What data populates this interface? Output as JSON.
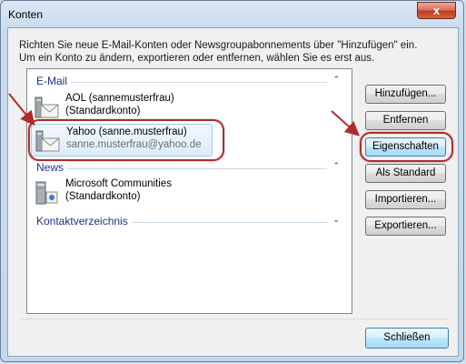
{
  "window": {
    "title": "Konten",
    "close_glyph": "x"
  },
  "info": {
    "line1": "Richten Sie neue E-Mail-Konten oder Newsgroupabonnements über \"Hinzufügen\" ein.",
    "line2": "Um ein Konto zu ändern, exportieren oder entfernen, wählen Sie es erst aus."
  },
  "groups": {
    "email": {
      "title": "E-Mail",
      "chevron": "⌃",
      "items": [
        {
          "line1": "AOL (sannemusterfrau)",
          "line2": "(Standardkonto)",
          "icon": "mail-account-icon"
        },
        {
          "line1": "Yahoo (sanne.musterfrau)",
          "line2": "sanne.musterfrau@yahoo.de",
          "icon": "mail-account-icon",
          "selected": true
        }
      ]
    },
    "news": {
      "title": "News",
      "chevron": "⌃",
      "items": [
        {
          "line1": "Microsoft Communities",
          "line2": "(Standardkonto)",
          "icon": "news-server-icon"
        }
      ]
    },
    "contacts": {
      "title": "Kontaktverzeichnis",
      "chevron": "⌄"
    }
  },
  "buttons": {
    "add": "Hinzufügen...",
    "remove": "Entfernen",
    "properties": "Eigenschaften",
    "default": "Als Standard",
    "import": "Importieren...",
    "export": "Exportieren...",
    "close": "Schließen"
  },
  "colors": {
    "annotation": "#b22a2a",
    "group_title": "#1e3287",
    "selection": "#dcebfc"
  }
}
